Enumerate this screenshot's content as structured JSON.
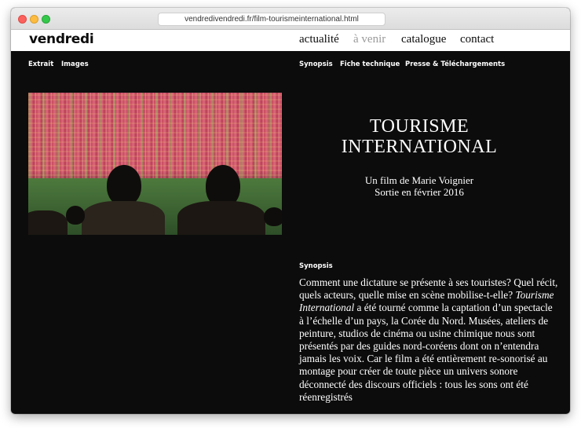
{
  "browser": {
    "url": "vendredivendredi.fr/film-tourismeinternational.html"
  },
  "site": {
    "logo": "vendredi",
    "nav": [
      "actualité",
      "à venir",
      "catalogue",
      "contact"
    ]
  },
  "subnav": {
    "left": [
      "Extrait",
      "Images"
    ],
    "right": [
      "Synopsis",
      "Fiche technique",
      "Presse & Téléchargements"
    ]
  },
  "film": {
    "title_line1": "TOURISME",
    "title_line2": "INTERNATIONAL",
    "director": "Un film de Marie Voignier",
    "release": "Sortie en février 2016"
  },
  "synopsis": {
    "label": "Synopsis",
    "text_before": "Comment une dictature se présente à ses touristes? Quel récit, quels acteurs, quelle mise en scène mobilise-t-elle? ",
    "title_italic": "Tourisme International",
    "text_after": " a été tourné comme la captation d’un spectacle à l’échelle d’un pays, la Corée du Nord. Musées, ateliers de peinture, studios de cinéma ou usine chimique nous sont présentés par des guides nord-coréens dont on n’entendra jamais les voix. Car le film a été entièrement re-sonorisé au montage pour créer de toute pièce un univers sonore déconnecté des discours officiels : tous les sons ont été réenregistrés"
  }
}
